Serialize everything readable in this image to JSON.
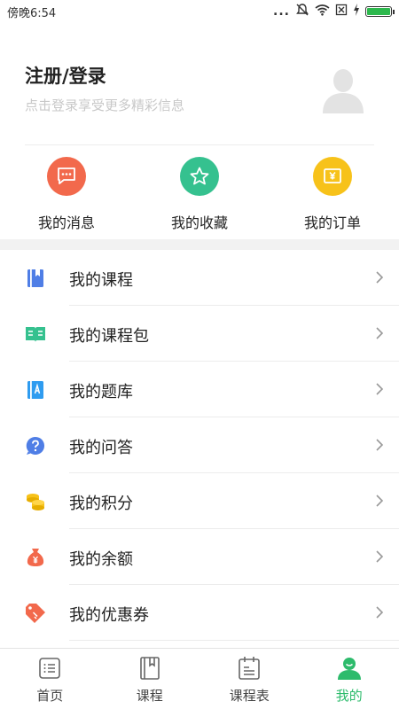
{
  "status_bar": {
    "time": "傍晚6:54",
    "dots": "...",
    "icons": [
      "mute-alarm-icon",
      "wifi-icon",
      "no-sim-icon",
      "charging-icon",
      "battery-icon"
    ]
  },
  "login": {
    "title": "注册/登录",
    "subtitle": "点击登录享受更多精彩信息"
  },
  "quick_actions": [
    {
      "label": "我的消息",
      "icon": "message-icon",
      "color": "#f2694c"
    },
    {
      "label": "我的收藏",
      "icon": "star-icon",
      "color": "#35c18f"
    },
    {
      "label": "我的订单",
      "icon": "order-icon",
      "color": "#f7c21a"
    }
  ],
  "menu": [
    {
      "label": "我的课程",
      "icon": "course-book-icon",
      "color": "#4f7ee6"
    },
    {
      "label": "我的课程包",
      "icon": "open-book-icon",
      "color": "#35c18f"
    },
    {
      "label": "我的题库",
      "icon": "question-bank-icon",
      "color": "#2f9cf0"
    },
    {
      "label": "我的问答",
      "icon": "question-icon",
      "color": "#4f7ee6"
    },
    {
      "label": "我的积分",
      "icon": "coins-icon",
      "color": "#f7c21a"
    },
    {
      "label": "我的余额",
      "icon": "money-bag-icon",
      "color": "#f2694c"
    },
    {
      "label": "我的优惠券",
      "icon": "coupon-icon",
      "color": "#f2694c"
    }
  ],
  "tabs": [
    {
      "label": "首页",
      "icon": "home-list-icon",
      "active": false
    },
    {
      "label": "课程",
      "icon": "course-icon",
      "active": false
    },
    {
      "label": "课程表",
      "icon": "schedule-icon",
      "active": false
    },
    {
      "label": "我的",
      "icon": "profile-icon",
      "active": true
    }
  ],
  "colors": {
    "accent": "#2dbb6c",
    "subtitle": "#c8c8c8",
    "band": "#f2f2f2"
  }
}
